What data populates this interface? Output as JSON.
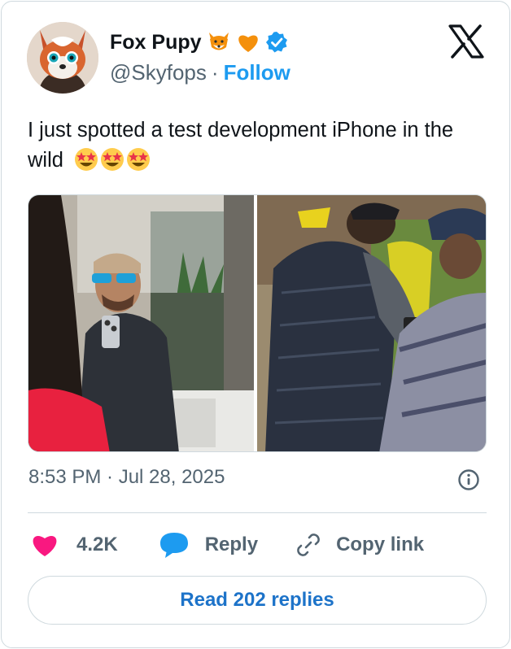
{
  "author": {
    "name": "Fox Pupy",
    "name_emojis": [
      "fox-face-emoji",
      "orange-heart-emoji"
    ],
    "handle": "@Skyfops",
    "separator": "·",
    "follow_label": "Follow",
    "verified": true
  },
  "tweet": {
    "text": "I just spotted a test development iPhone in the wild",
    "trailing_emojis": [
      "star-struck-emoji",
      "star-struck-emoji",
      "star-struck-emoji"
    ]
  },
  "media": {
    "photos": [
      "photo-man-holding-iphone",
      "photo-man-using-iphone"
    ]
  },
  "meta": {
    "timestamp": "8:53 PM · Jul 28, 2025"
  },
  "actions": {
    "likes": "4.2K",
    "reply_label": "Reply",
    "copy_label": "Copy link"
  },
  "footer": {
    "read_replies_label": "Read 202 replies"
  },
  "colors": {
    "accent": "#1d9bf0",
    "like": "#f91880",
    "secondary_text": "#536471",
    "border": "#cfd9de"
  }
}
